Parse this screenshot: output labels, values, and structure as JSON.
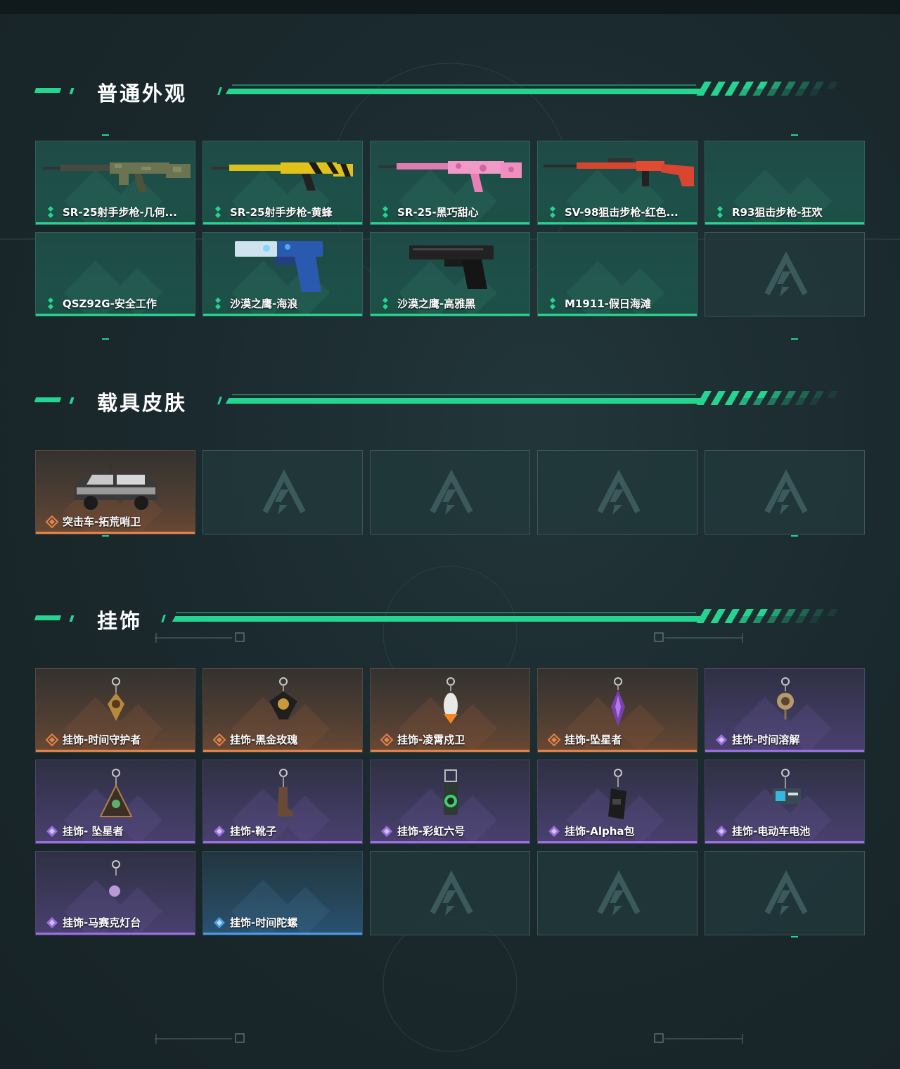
{
  "sections": {
    "weapon_skins": {
      "title": "普通外观",
      "items": [
        {
          "name": "SR-25射手步枪-几何...",
          "rarity": "green",
          "icon": "rifle-icon"
        },
        {
          "name": "SR-25射手步枪-黄蜂",
          "rarity": "green",
          "icon": "rifle-icon"
        },
        {
          "name": "SR-25-黑巧甜心",
          "rarity": "green",
          "icon": "rifle-icon"
        },
        {
          "name": "SV-98狙击步枪-红色...",
          "rarity": "green",
          "icon": "sniper-rifle-icon"
        },
        {
          "name": "R93狙击步枪-狂欢",
          "rarity": "green",
          "icon": "sniper-rifle-icon"
        },
        {
          "name": "QSZ92G-安全工作",
          "rarity": "green",
          "icon": "pistol-icon"
        },
        {
          "name": "沙漠之鹰-海浪",
          "rarity": "green",
          "icon": "pistol-icon"
        },
        {
          "name": "沙漠之鹰-高雅黑",
          "rarity": "green",
          "icon": "pistol-icon"
        },
        {
          "name": "M1911-假日海滩",
          "rarity": "green",
          "icon": "pistol-icon"
        }
      ],
      "empty_slots": 1
    },
    "vehicle_skins": {
      "title": "载具皮肤",
      "items": [
        {
          "name": "突击车-拓荒哨卫",
          "rarity": "orange",
          "icon": "armored-vehicle-icon"
        }
      ],
      "empty_slots": 4
    },
    "charms": {
      "title": "挂饰",
      "items": [
        {
          "name": "挂饰-时间守护者",
          "rarity": "orange",
          "icon": "charm-icon"
        },
        {
          "name": "挂饰-黑金玫瑰",
          "rarity": "orange",
          "icon": "charm-icon"
        },
        {
          "name": "挂饰-凌霄戍卫",
          "rarity": "orange",
          "icon": "charm-icon"
        },
        {
          "name": "挂饰-坠星者",
          "rarity": "orange",
          "icon": "charm-icon"
        },
        {
          "name": "挂饰-时间溶解",
          "rarity": "purple",
          "icon": "charm-icon"
        },
        {
          "name": "挂饰- 坠星者",
          "rarity": "purple",
          "icon": "charm-icon"
        },
        {
          "name": "挂饰-靴子",
          "rarity": "purple",
          "icon": "charm-icon"
        },
        {
          "name": "挂饰-彩虹六号",
          "rarity": "purple",
          "icon": "charm-icon"
        },
        {
          "name": "挂饰-Alpha包",
          "rarity": "purple",
          "icon": "charm-icon"
        },
        {
          "name": "挂饰-电动车电池",
          "rarity": "purple",
          "icon": "charm-icon"
        },
        {
          "name": "挂饰-马赛克灯台",
          "rarity": "purple",
          "icon": "charm-icon"
        },
        {
          "name": "挂饰-时间陀螺",
          "rarity": "blue",
          "icon": "charm-icon"
        }
      ],
      "empty_slots": 3
    }
  },
  "colors": {
    "accent": "#25d58f",
    "rarity_green": "#25d58f",
    "rarity_orange": "#e3824a",
    "rarity_purple": "#9b6fe0",
    "rarity_blue": "#4a9ae6"
  }
}
